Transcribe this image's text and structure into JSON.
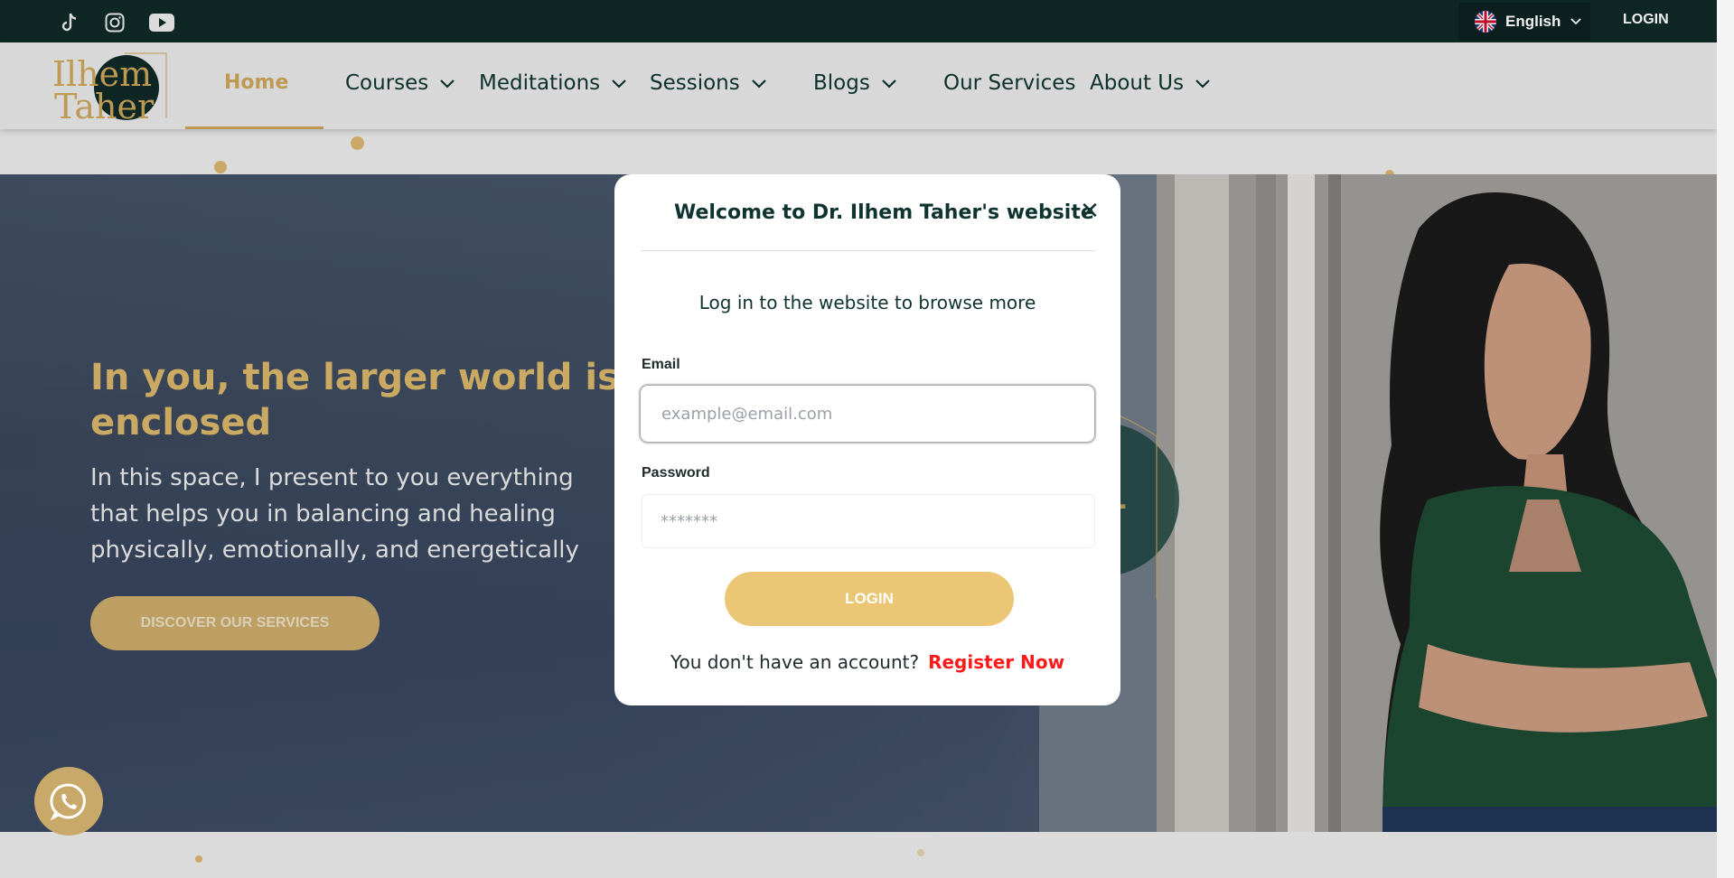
{
  "topbar": {
    "social": [
      {
        "name": "tiktok-icon"
      },
      {
        "name": "instagram-icon"
      },
      {
        "name": "youtube-icon"
      }
    ],
    "language": "English",
    "login": "LOGIN"
  },
  "nav": {
    "home": "Home",
    "courses": "Courses",
    "meditations": "Meditations",
    "sessions": "Sessions",
    "blogs": "Blogs",
    "services": "Our Services",
    "about": "About Us"
  },
  "hero": {
    "title": "In you, the larger world is enclosed",
    "text": "In this space, I present to you everything that helps you in balancing and healing physically, emotionally, and energetically",
    "button": "DISCOVER OUR SERVICES"
  },
  "modal": {
    "title": "Welcome to Dr. Ilhem Taher's website",
    "subtitle": "Log in to the website to browse more",
    "email_label": "Email",
    "email_placeholder": "example@email.com",
    "password_label": "Password",
    "password_placeholder": "*******",
    "login_button": "LOGIN",
    "no_account": "You don't have an account?",
    "register": "Register Now"
  },
  "colors": {
    "dark_green": "#0f2a27",
    "gold": "#c9a45a",
    "button_gold": "#ebc775",
    "register_red": "#ff1a1a"
  }
}
